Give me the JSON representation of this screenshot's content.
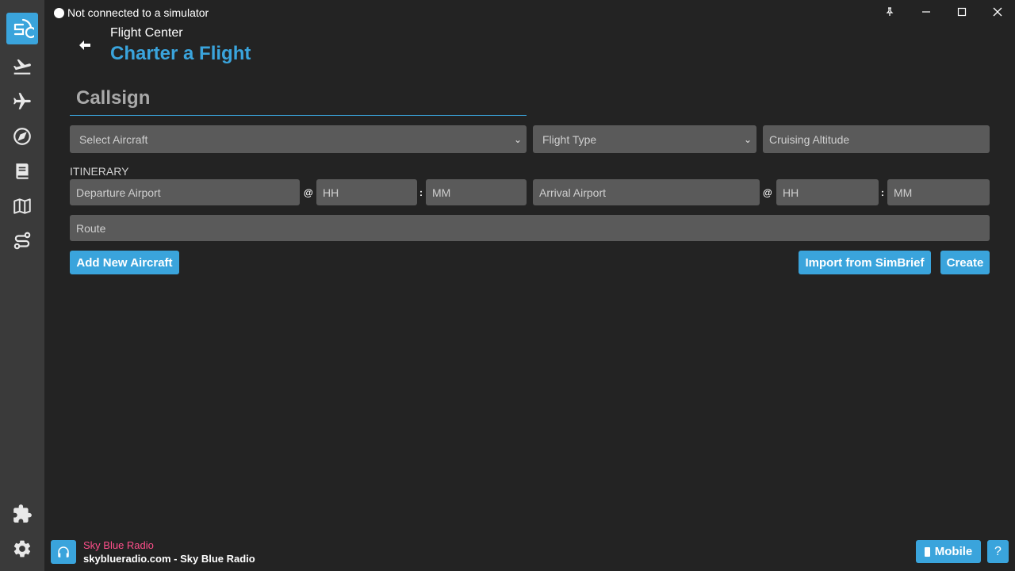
{
  "status": {
    "text": "Not connected to a simulator"
  },
  "header": {
    "crumb": "Flight Center",
    "title": "Charter a Flight"
  },
  "form": {
    "callsign_placeholder": "Callsign",
    "aircraft_placeholder": "Select Aircraft",
    "flight_type_placeholder": "Flight Type",
    "altitude_placeholder": "Cruising Altitude",
    "itinerary_label": "ITINERARY",
    "departure_placeholder": "Departure Airport",
    "arrival_placeholder": "Arrival Airport",
    "hh_placeholder": "HH",
    "mm_placeholder": "MM",
    "at_symbol": "@",
    "colon": ":",
    "route_placeholder": "Route"
  },
  "buttons": {
    "add_aircraft": "Add New Aircraft",
    "import_simbrief": "Import from SimBrief",
    "create": "Create",
    "mobile": "Mobile",
    "help": "?"
  },
  "radio": {
    "name": "Sky Blue Radio",
    "now_playing": "skyblueradio.com - Sky Blue Radio"
  },
  "colors": {
    "accent": "#3aa4dc",
    "radio_name": "#ff4f8b",
    "sidebar": "#3a3a3a",
    "background": "#232323",
    "field": "#5a5a5a"
  },
  "icons": [
    "app-logo-icon",
    "flight-departure-icon",
    "airplane-icon",
    "compass-icon",
    "book-icon",
    "map-icon",
    "route-icon",
    "puzzle-icon",
    "gear-icon",
    "headphones-icon",
    "mobile-icon",
    "pin-icon",
    "minimize-icon",
    "maximize-icon",
    "close-icon",
    "back-arrow-icon"
  ]
}
